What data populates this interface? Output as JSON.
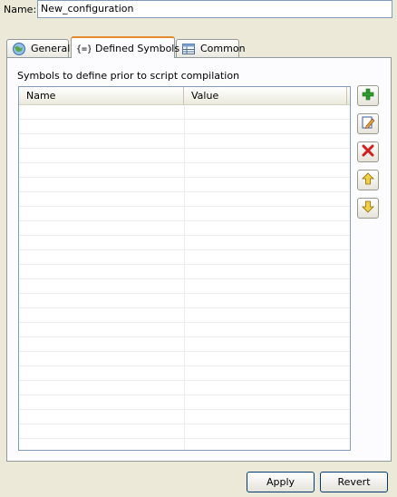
{
  "name_field": {
    "label": "Name:",
    "value": "New_configuration"
  },
  "tabs": [
    {
      "label": "General",
      "icon": "globe-icon",
      "active": false
    },
    {
      "label": "Defined Symbols",
      "icon": "braces-icon",
      "active": true
    },
    {
      "label": "Common",
      "icon": "table-icon",
      "active": false
    }
  ],
  "panel": {
    "caption": "Symbols to define prior to script compilation",
    "table": {
      "columns": [
        "Name",
        "Value"
      ],
      "rows": []
    }
  },
  "side_buttons": [
    {
      "icon": "add-icon",
      "color": "#2e9c2e"
    },
    {
      "icon": "edit-icon",
      "color": "#3c5aa0"
    },
    {
      "icon": "remove-icon",
      "color": "#d41e1e"
    },
    {
      "icon": "move-up-icon",
      "color": "#e8c020"
    },
    {
      "icon": "move-down-icon",
      "color": "#e8c020"
    }
  ],
  "buttons": {
    "apply": "Apply",
    "revert": "Revert"
  }
}
